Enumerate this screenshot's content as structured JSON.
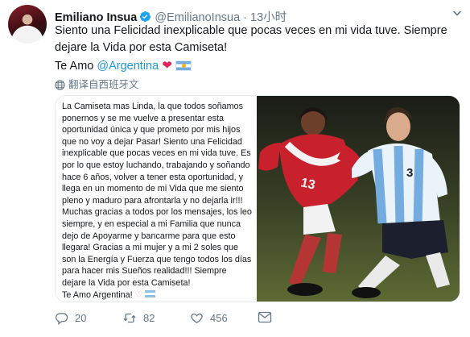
{
  "user": {
    "name": "Emiliano Insua",
    "handle": "@EmilianoInsua",
    "time": "13小时"
  },
  "tweet": {
    "line1": "Siento una Felicidad inexplicable que pocas veces en mi vida tuve. Siempre",
    "line2": "dejare la Vida por esta Camiseta!",
    "line3_prefix": "Te Amo ",
    "mention": "@Argentina",
    "heart": "❤"
  },
  "translate_label": "翻译自西班牙文",
  "note": {
    "body": "La Camiseta mas Linda, la que todos soñamos ponernos y se me vuelve a presentar esta oportunidad única y que prometo por mis hijos que no voy a dejar Pasar! Siento una Felicidad inexplicable que pocas veces en mi vida tuve. Es por lo que estoy luchando, trabajando y soñando hace 6 años, volver a tener esta oportunidad, y llega en un momento de mi Vida que me siento pleno y maduro para afrontarla y no dejarla ir!!! Muchas gracias a todos por los mensajes, los leo siempre, y en especial a mi Familia que nunca dejo de Apoyarme y bancarme para que esto llegara! Gracias a mi mujer y a mi 2 soles que son la Energía y Fuerza que tengo todos los días para hacer mis Sueños realidad!!! Siempre dejare la Vida por esta Camiseta!",
    "signoff": "Te Amo Argentina!",
    "heart": "♡"
  },
  "photo": {
    "jersey_number": "3"
  },
  "actions": {
    "replies": "20",
    "retweets": "82",
    "likes": "456"
  },
  "colors": {
    "link": "#1b95e0",
    "secondary": "#657786",
    "heart": "#e0245e",
    "verified": "#1da1f2"
  }
}
